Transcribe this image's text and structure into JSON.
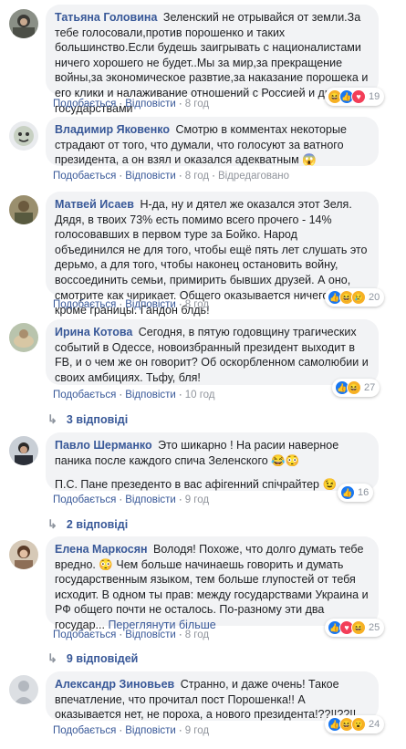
{
  "comments": [
    {
      "name": "Татьяна Головина",
      "text": "Зеленский не отрывайся от земли.За тебе голосовали,против порошенко и таких большинство.Если будешь заигрывать с националистами ничего хорошего не будет..Мы за мир,за прекращение войны,за экономическое развтие,за наказание порошека и его клики и налаживание отношений с Россией и другими государствами",
      "like": "Подобається",
      "reply": "Відповісти",
      "time": "8 год",
      "reaction_count": "19"
    },
    {
      "name": "Владимир Яковенко",
      "text": "Смотрю в комментах некоторые страдают от того, что думали, что голосуют за ватного президента, а он взял и оказался адекватным 😱",
      "like": "Подобається",
      "reply": "Відповісти",
      "time": "8 год",
      "edited": "Відредаговано"
    },
    {
      "name": "Матвей Исаев",
      "text": "Н-да, ну и дятел же оказался этот Зеля. Дядя, в твоих 73% есть помимо всего прочего - 14% голосовавших в первом туре за Бойко. Народ объединился не для того, чтобы ещё пять лет слушать это дерьмо, а для того, чтобы наконец остановить войну, воссоединить семьи, примирить бывших друзей. А оно, смотрите как чирикает. Общего оказывается ничего нет, кроме границы. Гандон блдь!",
      "like": "Подобається",
      "reply": "Відповісти",
      "time": "8 год",
      "reaction_count": "20"
    },
    {
      "name": "Ирина Котова",
      "text": "Сегодня, в пятую годовщину трагических событий в Одессе, новоизбранный президент выходит в FB, и о чем же он говорит? Об оскорбленном самолюбии и своих амбициях. Тьфу, бля!",
      "like": "Подобається",
      "reply": "Відповісти",
      "time": "10 год",
      "reaction_count": "27",
      "replies": "3 відповіді"
    },
    {
      "name": "Павло Шерманко",
      "text": "Это шикарно ! На расии наверное паника после каждого спича Зеленского 😂😳",
      "text2": "П.С. Пане презеденто в вас афігенний спічрайтер 😉",
      "like": "Подобається",
      "reply": "Відповісти",
      "time": "9 год",
      "reaction_count": "16",
      "replies": "2 відповіді"
    },
    {
      "name": "Елена Маркосян",
      "text": "Володя! Похоже, что долго думать тебе вредно. 😳 Чем больше начинаешь говорить и думать государственным языком, тем больше глупостей от тебя исходит. В одном ты прав: между государствами Украина и РФ общего почти не осталось. По-разному эти два государ...",
      "more": "Переглянути більше",
      "like": "Подобається",
      "reply": "Відповісти",
      "time": "8 год",
      "reaction_count": "25",
      "replies": "9 відповідей"
    },
    {
      "name": "Александр Зиновьев",
      "text": "Странно, и даже очень! Такое впечатление, что прочитал пост Порошенка!! А оказывается нет, не пороха, а нового президента!??!!??!!",
      "like": "Подобається",
      "reply": "Відповісти",
      "time": "9 год",
      "reaction_count": "24"
    }
  ],
  "colors": {
    "link": "#385898",
    "bubble": "#f2f3f5",
    "like": "#1877f2",
    "love": "#f33e58",
    "haha": "#f7b125"
  },
  "icons": {
    "reply_arrow": "reply-arrow-icon",
    "like": "like-reaction-icon",
    "love": "love-reaction-icon",
    "haha": "haha-reaction-icon"
  }
}
